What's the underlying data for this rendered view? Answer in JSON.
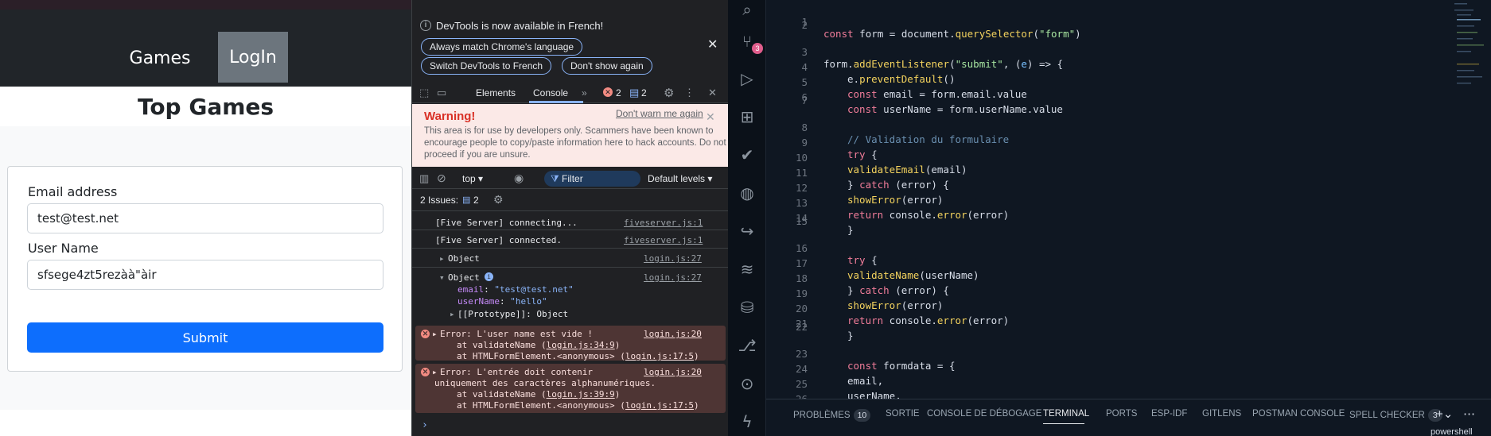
{
  "webpage": {
    "nav": {
      "games": "Games",
      "login": "LogIn"
    },
    "title": "Top Games",
    "form": {
      "email_label": "Email address",
      "email_value": "test@test.net",
      "username_label": "User Name",
      "username_value": "sfsege4zt5rezàà\"àir",
      "submit_label": "Submit"
    }
  },
  "devtools": {
    "infobar": {
      "message": "DevTools is now available in French!",
      "btn_match": "Always match Chrome's language",
      "btn_switch": "Switch DevTools to French",
      "btn_dont_show": "Don't show again"
    },
    "tabs": {
      "elements": "Elements",
      "console": "Console",
      "more": "»",
      "errors_count": "2",
      "messages_count": "2"
    },
    "warning": {
      "title": "Warning!",
      "dismiss": "Don't warn me again",
      "body": "This area is for use by developers only. Scammers have been known to encourage people to copy/paste information here to hack accounts. Do not proceed if you are unsure."
    },
    "console_toolbar": {
      "context": "top ▾",
      "filter": "Filter",
      "levels": "Default levels ▾"
    },
    "issues": {
      "label": "2 Issues:",
      "count": "2"
    },
    "logs": {
      "l1": "[Five Server] connecting...",
      "l1_src": "fiveserver.js:1",
      "l2": "[Five Server] connected.",
      "l2_src": "fiveserver.js:1",
      "l3": "Object",
      "l3_src": "login.js:27",
      "l4": "Object",
      "l4_src": "login.js:27",
      "l4_email_key": "email",
      "l4_email_val": "\"test@test.net\"",
      "l4_user_key": "userName",
      "l4_user_val": "\"hello\"",
      "l4_proto": "[[Prototype]]: Object",
      "e1": "Error: L'user name est vide !",
      "e1_src": "login.js:20",
      "e1_at1": "at validateName (",
      "e1_at1_link": "login.js:34:9",
      "e1_at2": "at HTMLFormElement.<anonymous> (",
      "e1_at2_link": "login.js:17:5",
      "e2_line1": "Error: L'entrée doit contenir",
      "e2_line2": "uniquement des caractères alphanumériques.",
      "e2_src": "login.js:20",
      "e2_at1": "at validateName (",
      "e2_at1_link": "login.js:39:9",
      "e2_at2": "at HTMLFormElement.<anonymous> (",
      "e2_at2_link": "login.js:17:5",
      "prompt": "›"
    }
  },
  "vscode": {
    "scm_badge": "3",
    "panel_tabs": {
      "problems": "PROBLÈMES",
      "problems_count": "10",
      "output": "SORTIE",
      "debug_console": "CONSOLE DE DÉBOGAGE",
      "terminal": "TERMINAL",
      "ports": "PORTS",
      "esp_idf": "ESP-IDF",
      "gitlens": "GITLENS",
      "postman": "POSTMAN CONSOLE",
      "spell_checker": "SPELL CHECKER",
      "spell_count": "3",
      "shell": "powershell"
    },
    "line_numbers": [
      "1",
      "2",
      "3",
      "4",
      "5",
      "6",
      "7",
      "8",
      "9",
      "10",
      "11",
      "12",
      "13",
      "14",
      "15",
      "16",
      "17",
      "18",
      "19",
      "20",
      "21",
      "22",
      "23",
      "24",
      "25",
      "26"
    ],
    "code": {
      "l1_a": "const",
      "l1_b": " form = ",
      "l1_c": "document",
      "l1_d": ".",
      "l1_e": "querySelector",
      "l1_f": "(",
      "l1_g": "\"form\"",
      "l1_h": ")",
      "l3_a": "form",
      "l3_b": ".",
      "l3_c": "addEventListener",
      "l3_d": "(",
      "l3_e": "\"submit\"",
      "l3_f": ", (",
      "l3_g": "e",
      "l3_h": ") => {",
      "l4_a": "e",
      "l4_b": ".",
      "l4_c": "preventDefault",
      "l4_d": "()",
      "l5_a": "const",
      "l5_b": " email = form.email.value",
      "l6_a": "const",
      "l6_b": " userName = form.userName.value",
      "l8": "// Validation du formulaire",
      "l9_a": "try",
      "l9_b": " {",
      "l10_a": "validateEmail",
      "l10_b": "(email)",
      "l11_a": "} ",
      "l11_b": "catch",
      "l11_c": " (error) {",
      "l12_a": "showError",
      "l12_b": "(error)",
      "l13_a": "return",
      "l13_b": " console.",
      "l13_c": "error",
      "l13_d": "(error)",
      "l14": "}",
      "l16_a": "try",
      "l16_b": " {",
      "l17_a": "validateName",
      "l17_b": "(userName)",
      "l18_a": "} ",
      "l18_b": "catch",
      "l18_c": " (error) {",
      "l19_a": "showError",
      "l19_b": "(error)",
      "l20_a": "return",
      "l20_b": " console.",
      "l20_c": "error",
      "l20_d": "(error)",
      "l21": "}",
      "l23_a": "const",
      "l23_b": " formdata = {",
      "l24": "email,",
      "l25": "userName,",
      "l26": "}"
    }
  },
  "colors": {
    "navbar": "#212529",
    "login_active": "#6c757d",
    "submit": "#0d6efd",
    "devtools_bg": "#202124",
    "error_row": "#4e3534",
    "vscode_bg": "#0f1722"
  }
}
